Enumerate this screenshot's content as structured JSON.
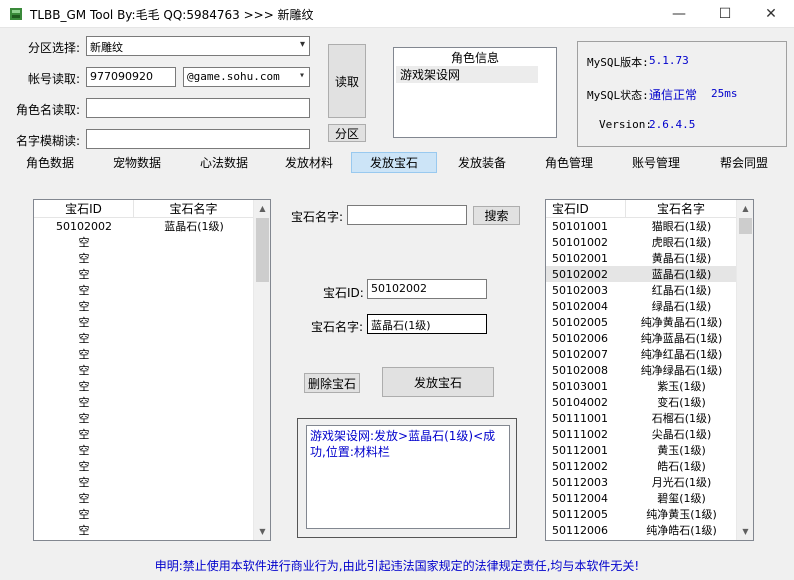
{
  "window": {
    "title": "TLBB_GM Tool By:毛毛 QQ:5984763 >>> 新雕纹",
    "minimize": "—",
    "maximize": "☐",
    "close": "✕"
  },
  "form": {
    "zone_label": "分区选择:",
    "zone_value": "新雕纹",
    "account_label": "帐号读取:",
    "account_value": "977090920",
    "domain_value": "@game.sohu.com",
    "rolename_label": "角色名读取:",
    "rolename_value": "",
    "fuzzy_label": "名字模糊读:",
    "fuzzy_value": "",
    "read_button": "读取",
    "zone_button": "分区"
  },
  "role_info": {
    "header": "角色信息",
    "rows": [
      "游戏架设网"
    ]
  },
  "mysql": {
    "version_label": "MySQL版本:",
    "version_value": "5.1.73",
    "status_label": "MySQL状态:",
    "status_value": "通信正常",
    "status_ms": "25ms",
    "app_version_label": "Version:",
    "app_version_value": "2.6.4.5"
  },
  "tabs": [
    "角色数据",
    "宠物数据",
    "心法数据",
    "发放材料",
    "发放宝石",
    "发放装备",
    "角色管理",
    "账号管理",
    "帮会同盟"
  ],
  "active_tab": 4,
  "left_list": {
    "col_id": "宝石ID",
    "col_name": "宝石名字",
    "rows": [
      {
        "id": "50102002",
        "name": "蓝晶石(1级)"
      },
      {
        "id": "空",
        "name": ""
      },
      {
        "id": "空",
        "name": ""
      },
      {
        "id": "空",
        "name": ""
      },
      {
        "id": "空",
        "name": ""
      },
      {
        "id": "空",
        "name": ""
      },
      {
        "id": "空",
        "name": ""
      },
      {
        "id": "空",
        "name": ""
      },
      {
        "id": "空",
        "name": ""
      },
      {
        "id": "空",
        "name": ""
      },
      {
        "id": "空",
        "name": ""
      },
      {
        "id": "空",
        "name": ""
      },
      {
        "id": "空",
        "name": ""
      },
      {
        "id": "空",
        "name": ""
      },
      {
        "id": "空",
        "name": ""
      },
      {
        "id": "空",
        "name": ""
      },
      {
        "id": "空",
        "name": ""
      },
      {
        "id": "空",
        "name": ""
      },
      {
        "id": "空",
        "name": ""
      },
      {
        "id": "空",
        "name": ""
      }
    ]
  },
  "middle": {
    "search_label": "宝石名字:",
    "search_value": "",
    "search_button": "搜索",
    "gem_id_label": "宝石ID:",
    "gem_id_value": "50102002",
    "gem_name_label": "宝石名字:",
    "gem_name_value": "蓝晶石(1级)",
    "delete_button": "删除宝石",
    "issue_button": "发放宝石",
    "log_text": "游戏架设网:发放>蓝晶石(1级)<成功,位置:材料栏"
  },
  "right_list": {
    "col_id": "宝石ID",
    "col_name": "宝石名字",
    "selected_index": 3,
    "rows": [
      {
        "id": "50101001",
        "name": "猫眼石(1级)"
      },
      {
        "id": "50101002",
        "name": "虎眼石(1级)"
      },
      {
        "id": "50102001",
        "name": "黄晶石(1级)"
      },
      {
        "id": "50102002",
        "name": "蓝晶石(1级)"
      },
      {
        "id": "50102003",
        "name": "红晶石(1级)"
      },
      {
        "id": "50102004",
        "name": "绿晶石(1级)"
      },
      {
        "id": "50102005",
        "name": "纯净黄晶石(1级)"
      },
      {
        "id": "50102006",
        "name": "纯净蓝晶石(1级)"
      },
      {
        "id": "50102007",
        "name": "纯净红晶石(1级)"
      },
      {
        "id": "50102008",
        "name": "纯净绿晶石(1级)"
      },
      {
        "id": "50103001",
        "name": "紫玉(1级)"
      },
      {
        "id": "50104002",
        "name": "变石(1级)"
      },
      {
        "id": "50111001",
        "name": "石榴石(1级)"
      },
      {
        "id": "50111002",
        "name": "尖晶石(1级)"
      },
      {
        "id": "50112001",
        "name": "黄玉(1级)"
      },
      {
        "id": "50112002",
        "name": "皓石(1级)"
      },
      {
        "id": "50112003",
        "name": "月光石(1级)"
      },
      {
        "id": "50112004",
        "name": "碧玺(1级)"
      },
      {
        "id": "50112005",
        "name": "纯净黄玉(1级)"
      },
      {
        "id": "50112006",
        "name": "纯净皓石(1级)"
      }
    ]
  },
  "footer": "申明:禁止使用本软件进行商业行为,由此引起违法国家规定的法律规定责任,均与本软件无关!"
}
